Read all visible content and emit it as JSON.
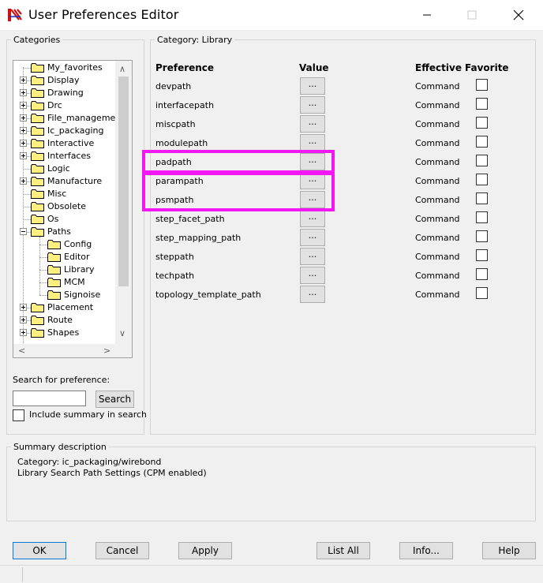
{
  "window": {
    "title": "User Preferences Editor"
  },
  "categories": {
    "label": "Categories",
    "tree": [
      {
        "label": "My_favorites",
        "expander": "none",
        "depth": 0
      },
      {
        "label": "Display",
        "expander": "closed",
        "depth": 0
      },
      {
        "label": "Drawing",
        "expander": "closed",
        "depth": 0
      },
      {
        "label": "Drc",
        "expander": "closed",
        "depth": 0
      },
      {
        "label": "File_management",
        "expander": "closed",
        "depth": 0
      },
      {
        "label": "Ic_packaging",
        "expander": "closed",
        "depth": 0
      },
      {
        "label": "Interactive",
        "expander": "closed",
        "depth": 0
      },
      {
        "label": "Interfaces",
        "expander": "closed",
        "depth": 0
      },
      {
        "label": "Logic",
        "expander": "none",
        "depth": 0
      },
      {
        "label": "Manufacture",
        "expander": "closed",
        "depth": 0
      },
      {
        "label": "Misc",
        "expander": "none",
        "depth": 0
      },
      {
        "label": "Obsolete",
        "expander": "none",
        "depth": 0
      },
      {
        "label": "Os",
        "expander": "none",
        "depth": 0
      },
      {
        "label": "Paths",
        "expander": "open",
        "depth": 0
      },
      {
        "label": "Config",
        "expander": "none",
        "depth": 1
      },
      {
        "label": "Editor",
        "expander": "none",
        "depth": 1
      },
      {
        "label": "Library",
        "expander": "none",
        "depth": 1
      },
      {
        "label": "MCM",
        "expander": "none",
        "depth": 1
      },
      {
        "label": "Signoise",
        "expander": "none",
        "depth": 1
      },
      {
        "label": "Placement",
        "expander": "closed",
        "depth": 0
      },
      {
        "label": "Route",
        "expander": "closed",
        "depth": 0
      },
      {
        "label": "Shapes",
        "expander": "closed",
        "depth": 0
      }
    ],
    "search_label": "Search for preference:",
    "search_value": "",
    "search_button": "Search",
    "include_summary_label": "Include summary in search"
  },
  "category_panel": {
    "label": "Category:  Library",
    "headers": {
      "preference": "Preference",
      "value": "Value",
      "effective": "Effective",
      "favorite": "Favorite"
    },
    "rows": [
      {
        "name": "devpath",
        "value_button": "...",
        "effective": "Command"
      },
      {
        "name": "interfacepath",
        "value_button": "...",
        "effective": "Command"
      },
      {
        "name": "miscpath",
        "value_button": "...",
        "effective": "Command"
      },
      {
        "name": "modulepath",
        "value_button": "...",
        "effective": "Command"
      },
      {
        "name": "padpath",
        "value_button": "...",
        "effective": "Command"
      },
      {
        "name": "parampath",
        "value_button": "...",
        "effective": "Command"
      },
      {
        "name": "psmpath",
        "value_button": "...",
        "effective": "Command"
      },
      {
        "name": "step_facet_path",
        "value_button": "...",
        "effective": "Command"
      },
      {
        "name": "step_mapping_path",
        "value_button": "...",
        "effective": "Command"
      },
      {
        "name": "steppath",
        "value_button": "...",
        "effective": "Command"
      },
      {
        "name": "techpath",
        "value_button": "...",
        "effective": "Command"
      },
      {
        "name": "topology_template_path",
        "value_button": "...",
        "effective": "Command"
      }
    ]
  },
  "summary": {
    "label": "Summary description",
    "line1": "Category: ic_packaging/wirebond",
    "line2": "Library Search Path Settings (CPM enabled)"
  },
  "buttons": {
    "ok": "OK",
    "cancel": "Cancel",
    "apply": "Apply",
    "list_all": "List All",
    "info": "Info...",
    "help": "Help"
  },
  "colors": {
    "highlight": "#f318f3",
    "folder": "#ffee80",
    "accent": "#0078d7"
  },
  "icons": {
    "app": "pcb-editor-icon",
    "folder": "folder-icon",
    "minimize": "minimize-icon",
    "maximize": "maximize-icon",
    "close": "close-icon"
  }
}
